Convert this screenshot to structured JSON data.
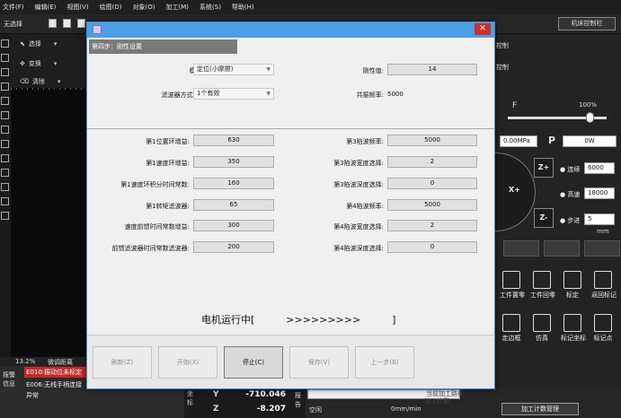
{
  "menu": [
    "文件(F)",
    "编辑(E)",
    "视图(V)",
    "绘图(D)",
    "对象(O)",
    "加工(M)",
    "系统(S)",
    "帮助(H)"
  ],
  "toolbar": {
    "selection_label": "无选择",
    "machine_panel": "机床控制栏"
  },
  "left_tools": {
    "select": "选择",
    "transform": "变换",
    "clear": "清除"
  },
  "status": {
    "zoom": "13.2%",
    "mode": "微调距离"
  },
  "alarms": {
    "label": "报警信息",
    "items": [
      "E010:振动位未标定",
      "E006:无线手柄连接异常"
    ]
  },
  "coords": {
    "side_label": "坐标",
    "y_axis": "Y",
    "y_value": "-710.046",
    "z_axis": "Z",
    "z_value": "-8.207"
  },
  "bottom": {
    "side_label": "报告",
    "current_line": "当前加工路径",
    "count_label": "加工计数:",
    "state": "空闲",
    "length": "0mm/min",
    "count_button": "加工计数管理"
  },
  "right_panel": {
    "title": "控制",
    "f_label": "F",
    "feed_percent": "100%",
    "pressure": "0.00MPa",
    "p_label": "P",
    "power": "0W",
    "z_plus": "Z+",
    "z_minus": "Z-",
    "x_plus": "X+",
    "speeds": [
      {
        "label": "连续",
        "value": "6000"
      },
      {
        "label": "高速",
        "value": "18000"
      },
      {
        "label": "步进",
        "value": "5",
        "unit": "mm"
      }
    ],
    "tools_row1": [
      "工件置零",
      "工件回零",
      "标定",
      "返回标记"
    ],
    "tools_row2": [
      "走边框",
      "仿真",
      "标记坐标",
      "标记点"
    ]
  },
  "dialog": {
    "step_title": "第四步：刚性设置",
    "mode_label": "模式:",
    "mode_value": "定位(小摩擦)",
    "rigidity_label": "刚性值:",
    "rigidity_value": "14",
    "filter_label": "滤波器方式:",
    "filter_value": "1个有效",
    "resonance_label": "共振频率:",
    "resonance_value": "5000",
    "left_params": [
      {
        "label": "第1位置环增益:",
        "value": "630"
      },
      {
        "label": "第1速度环增益:",
        "value": "350"
      },
      {
        "label": "第1速度环积分时间常数:",
        "value": "160"
      },
      {
        "label": "第1转矩滤波器:",
        "value": "65"
      },
      {
        "label": "速度前馈时间常数增益:",
        "value": "300"
      },
      {
        "label": "前馈滤波器时间常数滤波器:",
        "value": "200"
      }
    ],
    "right_params": [
      {
        "label": "第3陷波频率:",
        "value": "5000"
      },
      {
        "label": "第3陷波宽度选择:",
        "value": "2"
      },
      {
        "label": "第3陷波深度选择:",
        "value": "0"
      },
      {
        "label": "第4陷波频率:",
        "value": "5000"
      },
      {
        "label": "第4陷波宽度选择:",
        "value": "2"
      },
      {
        "label": "第4陷波深度选择:",
        "value": "0"
      }
    ],
    "running_text": "电机运行中[          >>>>>>>>>          ]",
    "buttons": [
      {
        "label": "刷新(Z)",
        "active": false
      },
      {
        "label": "开始(X)",
        "active": false
      },
      {
        "label": "停止(C)",
        "active": true
      },
      {
        "label": "保存(V)",
        "active": false
      },
      {
        "label": "上一步(B)",
        "active": false
      }
    ]
  }
}
